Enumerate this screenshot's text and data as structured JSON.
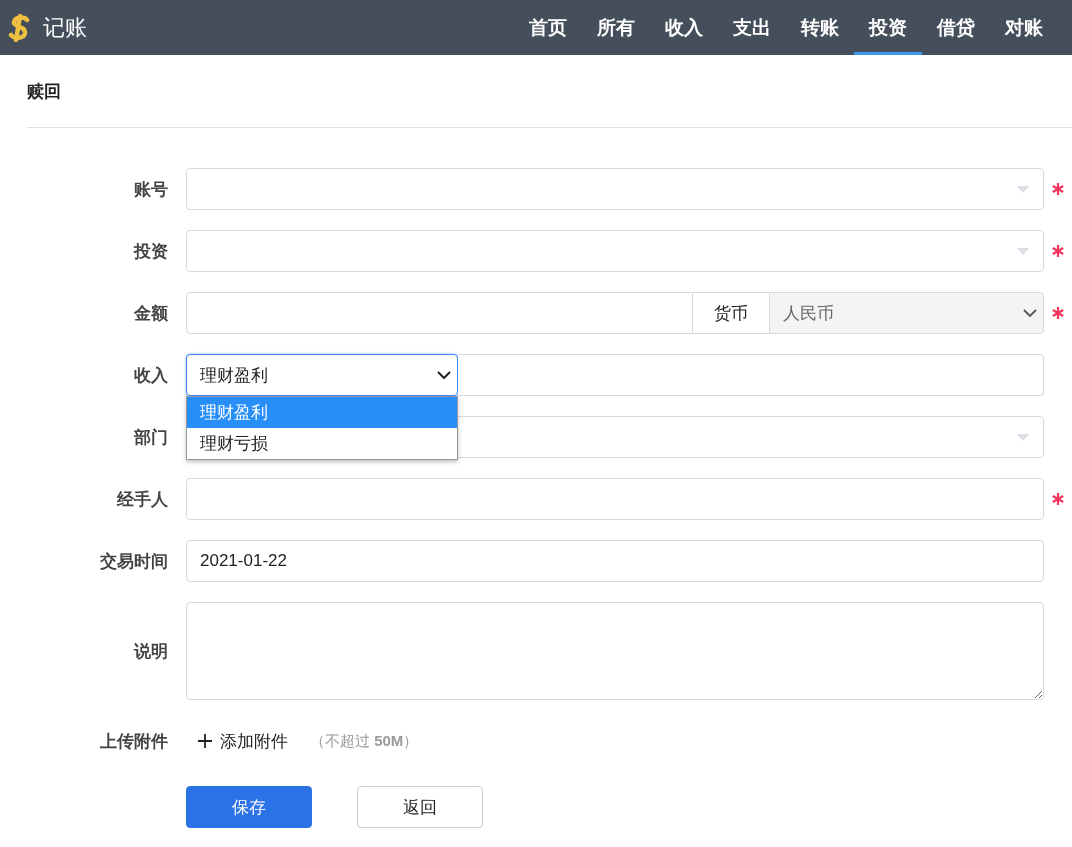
{
  "app": {
    "title": "记账"
  },
  "nav": [
    {
      "label": "首页",
      "selected": false
    },
    {
      "label": "所有",
      "selected": false
    },
    {
      "label": "收入",
      "selected": false
    },
    {
      "label": "支出",
      "selected": false
    },
    {
      "label": "转账",
      "selected": false
    },
    {
      "label": "投资",
      "selected": true
    },
    {
      "label": "借贷",
      "selected": false
    },
    {
      "label": "对账",
      "selected": false
    }
  ],
  "page_title": "赎回",
  "fields": [
    {
      "kind": "select",
      "label": "账号",
      "required": true
    },
    {
      "kind": "select",
      "label": "投资",
      "required": true
    },
    {
      "kind": "amount",
      "label": "金额",
      "required": true,
      "addon": "货币",
      "currency": "人民币"
    },
    {
      "kind": "dropdown",
      "label": "收入",
      "required": false,
      "value": "理财盈利",
      "options": [
        {
          "label": "理财盈利",
          "selected": true
        },
        {
          "label": "理财亏损",
          "selected": false
        }
      ]
    },
    {
      "kind": "select",
      "label": "部门",
      "required": false
    },
    {
      "kind": "input",
      "label": "经手人",
      "required": true
    },
    {
      "kind": "input",
      "label": "交易时间",
      "required": false,
      "value": "2021-01-22"
    },
    {
      "kind": "textarea",
      "label": "说明",
      "required": false
    }
  ],
  "attachment": {
    "label": "上传附件",
    "button": "添加附件",
    "note": "（不超过 **50M**）"
  },
  "buttons": [
    {
      "label": "保存",
      "kind": "primary"
    },
    {
      "label": "返回",
      "kind": "default"
    }
  ]
}
